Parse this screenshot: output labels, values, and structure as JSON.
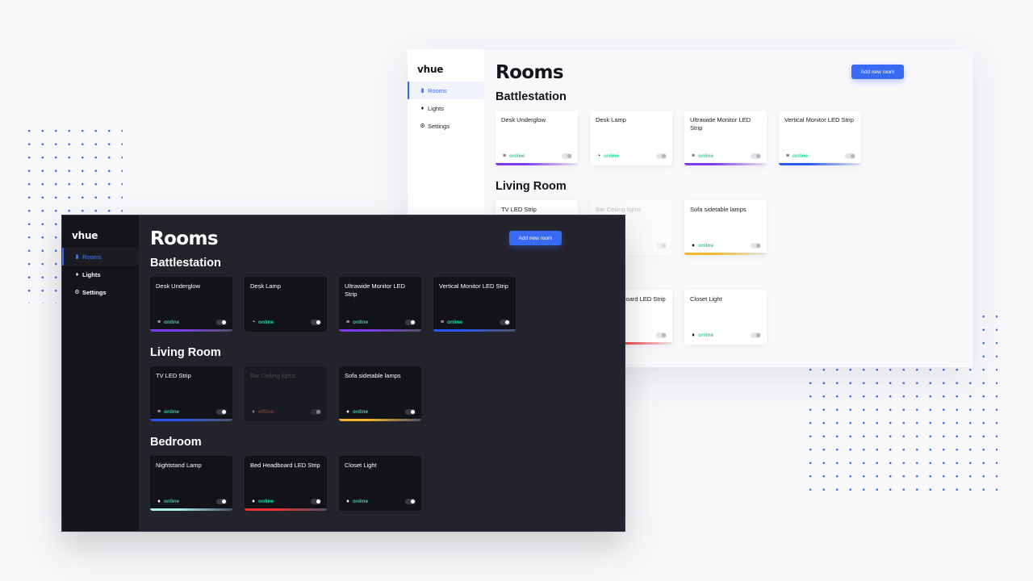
{
  "brand": "vhue",
  "nav": [
    {
      "label": "Rooms",
      "icon": "lightbulb-strip-icon",
      "active": true
    },
    {
      "label": "Lights",
      "icon": "bulb-icon",
      "active": false
    },
    {
      "label": "Settings",
      "icon": "gear-icon",
      "active": false
    }
  ],
  "page_title": "Rooms",
  "add_button": "Add new room",
  "status_online": "online",
  "status_offline": "offline",
  "rooms": [
    {
      "name": "Battlestation",
      "lights": [
        {
          "name": "Desk Underglow",
          "status": "online",
          "icon": "led-strip-icon",
          "on": true,
          "color": "#7c3aed"
        },
        {
          "name": "Desk Lamp",
          "status": "online",
          "icon": "desk-lamp-icon",
          "on": true,
          "color": ""
        },
        {
          "name": "Ultrawide Monitor LED Strip",
          "status": "online",
          "icon": "led-strip-icon",
          "on": true,
          "color": "#7c3aed"
        },
        {
          "name": "Vertical Monitor LED Strip",
          "status": "online",
          "icon": "led-strip-icon",
          "on": true,
          "color": "#2957f0"
        }
      ]
    },
    {
      "name": "Living Room",
      "lights": [
        {
          "name": "TV LED Strip",
          "status": "online",
          "icon": "led-strip-icon",
          "on": true,
          "color": "#2957f0"
        },
        {
          "name": "Bar Ceiling lights",
          "status": "offline",
          "icon": "bulb-icon",
          "on": false,
          "color": ""
        },
        {
          "name": "Sofa sidetable lamps",
          "status": "online",
          "icon": "bulb-icon",
          "on": true,
          "color": "#f5b52e"
        }
      ]
    },
    {
      "name": "Bedroom",
      "lights": [
        {
          "name": "Nightstand Lamp",
          "status": "online",
          "icon": "bulb-icon",
          "on": true,
          "color": "#a8efe6"
        },
        {
          "name": "Bed Headboard LED Strip",
          "status": "online",
          "icon": "bulb-icon",
          "on": true,
          "color": "#ef2f2f"
        },
        {
          "name": "Closet Light",
          "status": "online",
          "icon": "bulb-icon",
          "on": true,
          "color": ""
        }
      ]
    }
  ]
}
